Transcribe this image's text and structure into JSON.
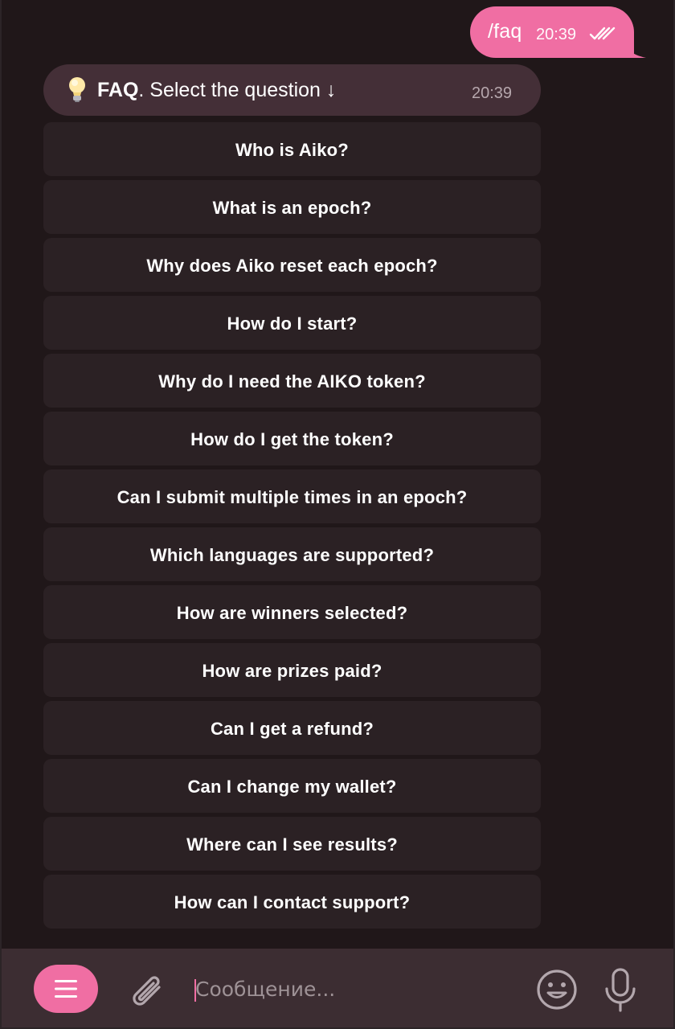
{
  "outgoing": {
    "text": "/faq",
    "time": "20:39",
    "status_icon": "double-check-icon"
  },
  "incoming": {
    "icon": "lightbulb-icon",
    "title_bold": "FAQ",
    "title_rest": ". Select the question ↓",
    "time": "20:39"
  },
  "keyboard": [
    "Who is Aiko?",
    "What is an epoch?",
    "Why does Aiko reset each epoch?",
    "How do I start?",
    "Why do I need the AIKO token?",
    "How do I get the token?",
    "Can I submit multiple times in an epoch?",
    "Which languages are supported?",
    "How are winners selected?",
    "How are prizes paid?",
    "Can I get a refund?",
    "Can I change my wallet?",
    "Where can I see results?",
    "How can I contact support?"
  ],
  "composer": {
    "placeholder": "Сообщение...",
    "menu_icon": "menu-icon",
    "attach_icon": "paperclip-icon",
    "emoji_icon": "smiley-icon",
    "mic_icon": "microphone-icon"
  },
  "colors": {
    "accent": "#f06ea3",
    "chat_bg": "#201719",
    "incoming_bg": "#442f37",
    "button_bg": "#2b2124",
    "composer_bg": "#3c2d32"
  }
}
